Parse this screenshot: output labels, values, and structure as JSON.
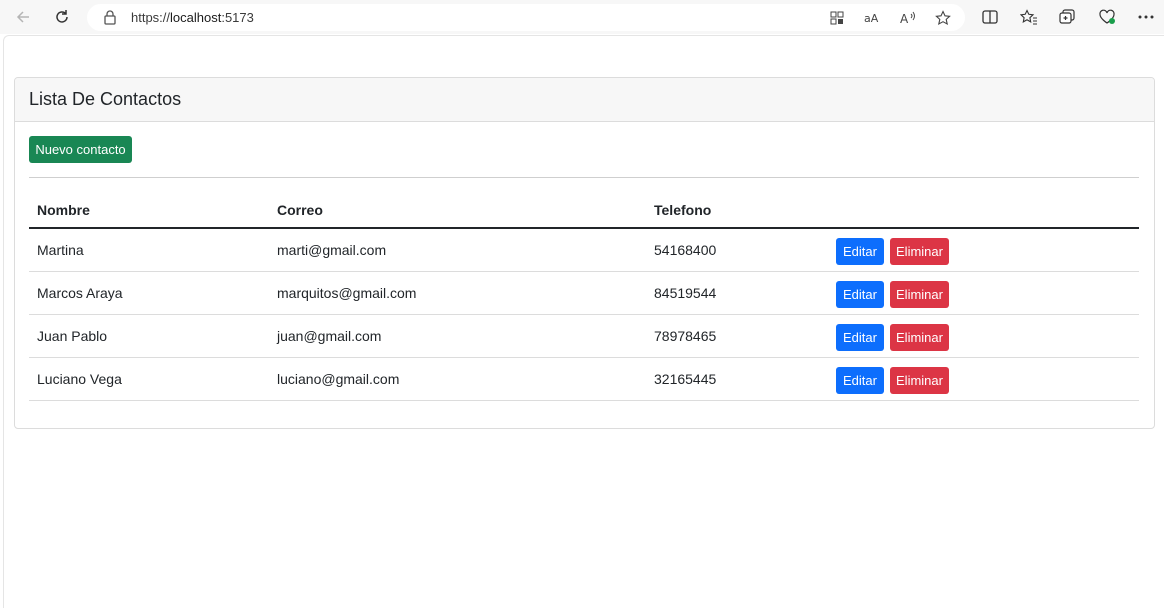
{
  "browser": {
    "url_scheme": "https://",
    "url_host": "localhost",
    "url_port": ":5173"
  },
  "card": {
    "title": "Lista De Contactos",
    "new_button_label": "Nuevo contacto"
  },
  "table": {
    "headers": [
      "Nombre",
      "Correo",
      "Telefono",
      ""
    ],
    "rows": [
      {
        "nombre": "Martina",
        "correo": "marti@gmail.com",
        "telefono": "54168400"
      },
      {
        "nombre": "Marcos Araya",
        "correo": "marquitos@gmail.com",
        "telefono": "84519544"
      },
      {
        "nombre": "Juan Pablo",
        "correo": "juan@gmail.com",
        "telefono": "78978465"
      },
      {
        "nombre": "Luciano Vega",
        "correo": "luciano@gmail.com",
        "telefono": "32165445"
      }
    ],
    "edit_label": "Editar",
    "delete_label": "Eliminar"
  },
  "colors": {
    "success": "#198754",
    "primary": "#0d6efd",
    "danger": "#dc3545"
  },
  "icons": [
    "back-icon",
    "reload-icon",
    "lock-icon",
    "app-grid-icon",
    "translate-icon",
    "read-aloud-icon",
    "favorite-star-icon",
    "split-screen-icon",
    "favorites-icon",
    "collections-icon",
    "browser-essentials-icon",
    "more-options-icon"
  ]
}
